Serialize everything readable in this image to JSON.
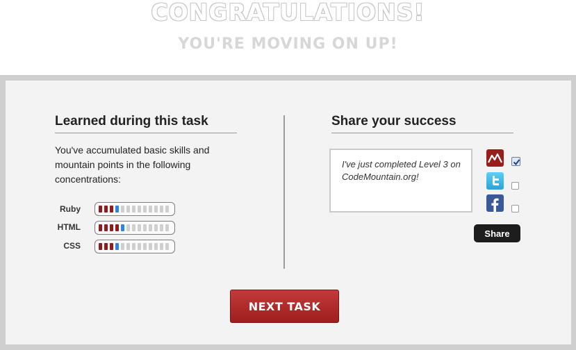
{
  "hero": {
    "title": "CONGRATULATIONS!",
    "subtitle": "YOU'RE MOVING ON UP!"
  },
  "learned": {
    "heading": "Learned during this task",
    "blurb": "You've accumulated basic skills and mountain points in the following concentrations:",
    "skills": [
      {
        "label": "Ruby",
        "completed": 3,
        "gained": 1,
        "total": 13
      },
      {
        "label": "HTML",
        "completed": 4,
        "gained": 1,
        "total": 13
      },
      {
        "label": "CSS",
        "completed": 3,
        "gained": 1,
        "total": 13
      }
    ]
  },
  "share": {
    "heading": "Share your success",
    "message": "I've just completed Level 3 on CodeMountain.org!",
    "networks": [
      {
        "name": "codemountain-icon",
        "checked": true
      },
      {
        "name": "twitter-icon",
        "checked": false
      },
      {
        "name": "facebook-icon",
        "checked": false
      }
    ],
    "button_label": "Share"
  },
  "next_button_label": "NEXT TASK",
  "colors": {
    "brand_red": "#9e1e1e",
    "progress_red": "#8f1d1d",
    "progress_blue": "#2f86d9",
    "frame_gray": "#cfcfcf"
  }
}
